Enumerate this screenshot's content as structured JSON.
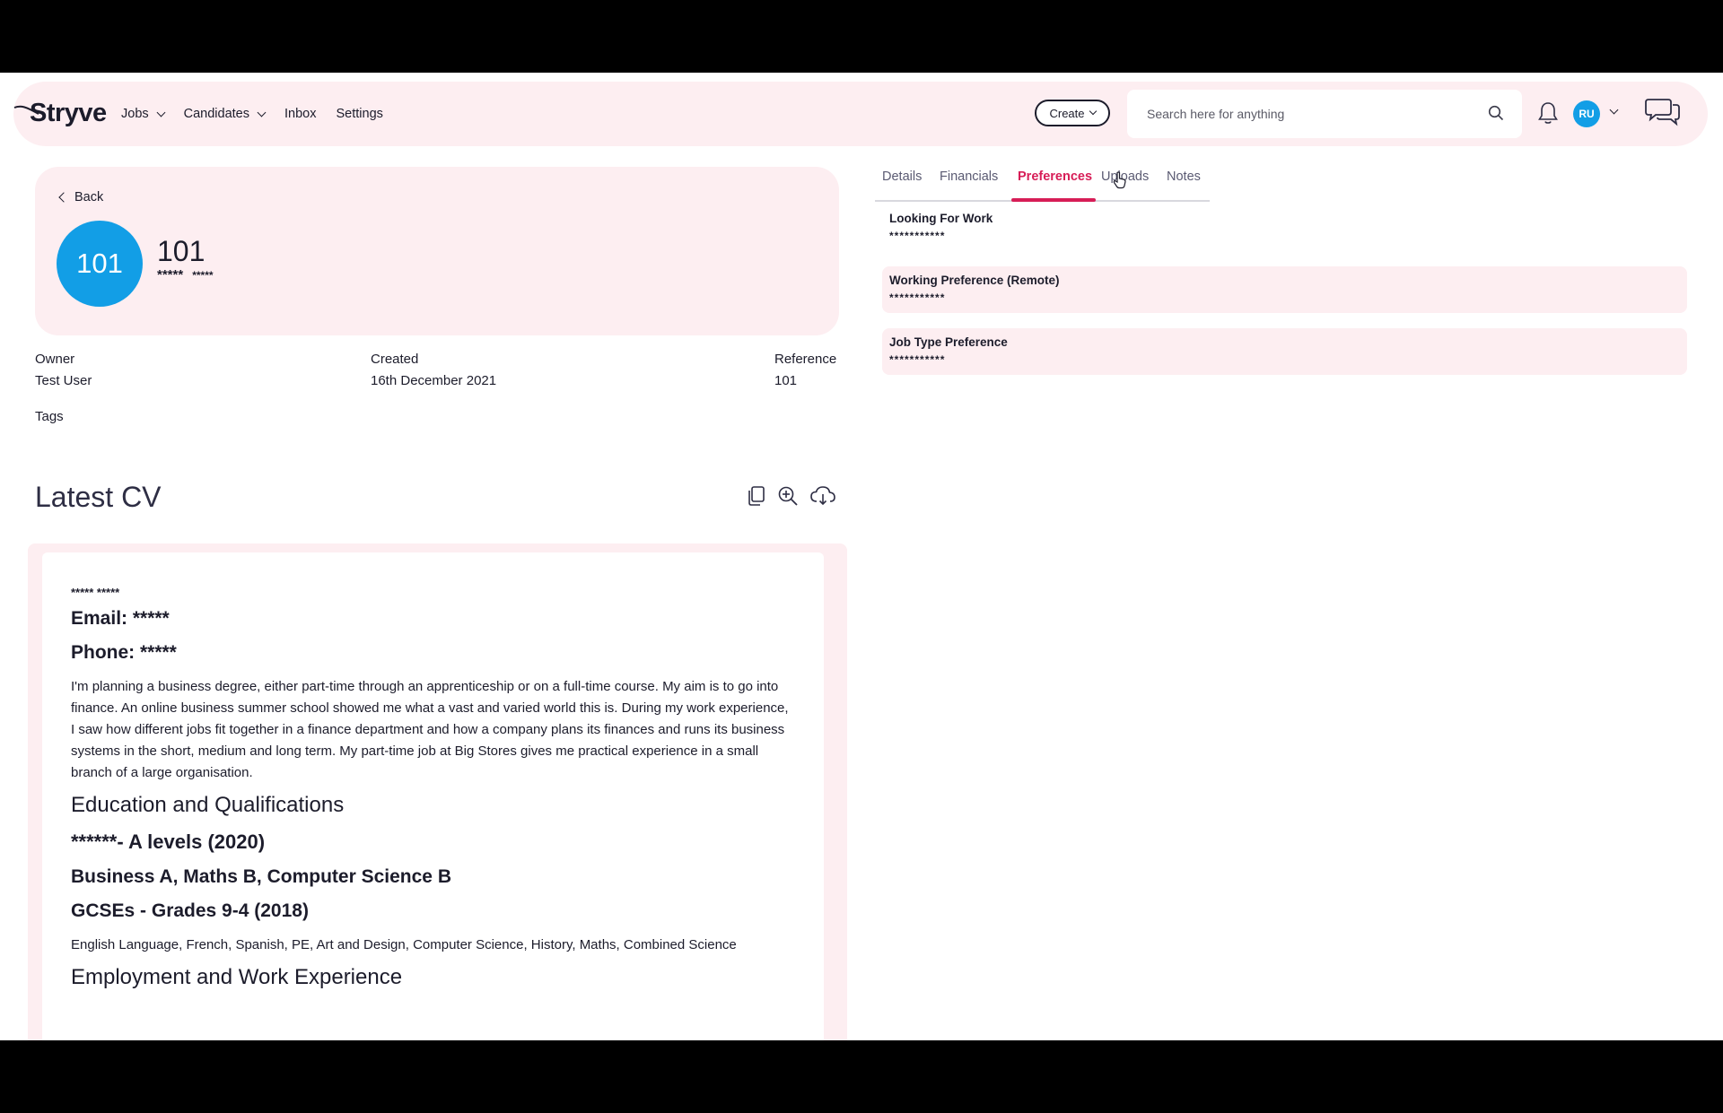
{
  "brand": {
    "logo_text": "Stryve"
  },
  "nav": {
    "jobs": "Jobs",
    "candidates": "Candidates",
    "inbox": "Inbox",
    "settings": "Settings"
  },
  "header": {
    "create_label": "Create",
    "search_placeholder": "Search here for anything",
    "avatar_initials": "RU"
  },
  "profile": {
    "back_label": "Back",
    "avatar_text": "101",
    "name": "101",
    "sub_first": "*****",
    "sub_last": "*****"
  },
  "meta": {
    "owner_label": "Owner",
    "owner_value": "Test User",
    "created_label": "Created",
    "created_value": "16th December 2021",
    "reference_label": "Reference",
    "reference_value": "101",
    "tags_label": "Tags"
  },
  "cv": {
    "title": "Latest CV",
    "name_masked": "***** *****",
    "email": "Email: *****",
    "phone": "Phone: *****",
    "summary": "I'm planning a business degree, either part-time through an apprenticeship or on a full-time course. My aim is to go into finance. An online business summer school showed me what a vast and varied world this is. During my work experience, I saw how different jobs fit together in a finance department and how a company plans its finances and runs its business systems in the short, medium and long term. My part-time job at Big Stores gives me practical experience in a small branch of a large organisation.",
    "education_heading": "Education and Qualifications",
    "alevels_heading": "******- A levels (2020)",
    "alevels_subjects": "Business A, Maths B, Computer Science B",
    "gcse_heading": "GCSEs - Grades 9-4 (2018)",
    "gcse_subjects": "English Language, French, Spanish, PE, Art and Design, Computer Science, History, Maths, Combined Science",
    "employment_heading": "Employment and Work Experience"
  },
  "tabs": [
    {
      "label": "Details"
    },
    {
      "label": "Financials"
    },
    {
      "label": "Preferences",
      "active": true
    },
    {
      "label": "Uploads"
    },
    {
      "label": "Notes"
    }
  ],
  "preferences": [
    {
      "label": "Looking For Work",
      "value": "***********"
    },
    {
      "label": "Working Preference (Remote)",
      "value": "***********"
    },
    {
      "label": "Job Type Preference",
      "value": "***********"
    }
  ],
  "colors": {
    "accent": "#d71d57",
    "brand_blue": "#129ee6",
    "panel_pink": "#fdeef1"
  }
}
